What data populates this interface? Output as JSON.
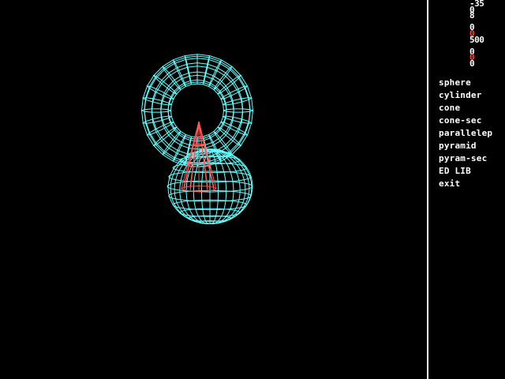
{
  "colors": {
    "background": "#000000",
    "torus": "#66ffff",
    "sphere": "#66ffff",
    "cone": "#ff5555",
    "text": "#ffffff",
    "param_white": "#ffffff",
    "param_red": "#ff4444",
    "divider": "#ffffff"
  },
  "scene": {
    "objects": [
      {
        "kind": "torus",
        "name": "torus-wireframe"
      },
      {
        "kind": "sphere",
        "name": "sphere-wireframe"
      },
      {
        "kind": "cone",
        "name": "cone-wireframe"
      }
    ]
  },
  "params": [
    {
      "value": "-35",
      "color": "white"
    },
    {
      "value": "0",
      "color": "white"
    },
    {
      "value": "8",
      "color": "white"
    },
    {
      "value": "0",
      "color": "white"
    },
    {
      "value": "0",
      "color": "red"
    },
    {
      "value": "500",
      "color": "white"
    },
    {
      "value": "0",
      "color": "white"
    },
    {
      "value": "0",
      "color": "red"
    },
    {
      "value": "0",
      "color": "white"
    }
  ],
  "menu": {
    "items": [
      {
        "label": "sphere"
      },
      {
        "label": "cylinder"
      },
      {
        "label": "cone"
      },
      {
        "label": "cone-sec"
      },
      {
        "label": "parallelep"
      },
      {
        "label": "pyramid"
      },
      {
        "label": "pyram-sec"
      },
      {
        "label": "ED LIB"
      },
      {
        "label": "exit"
      }
    ]
  }
}
